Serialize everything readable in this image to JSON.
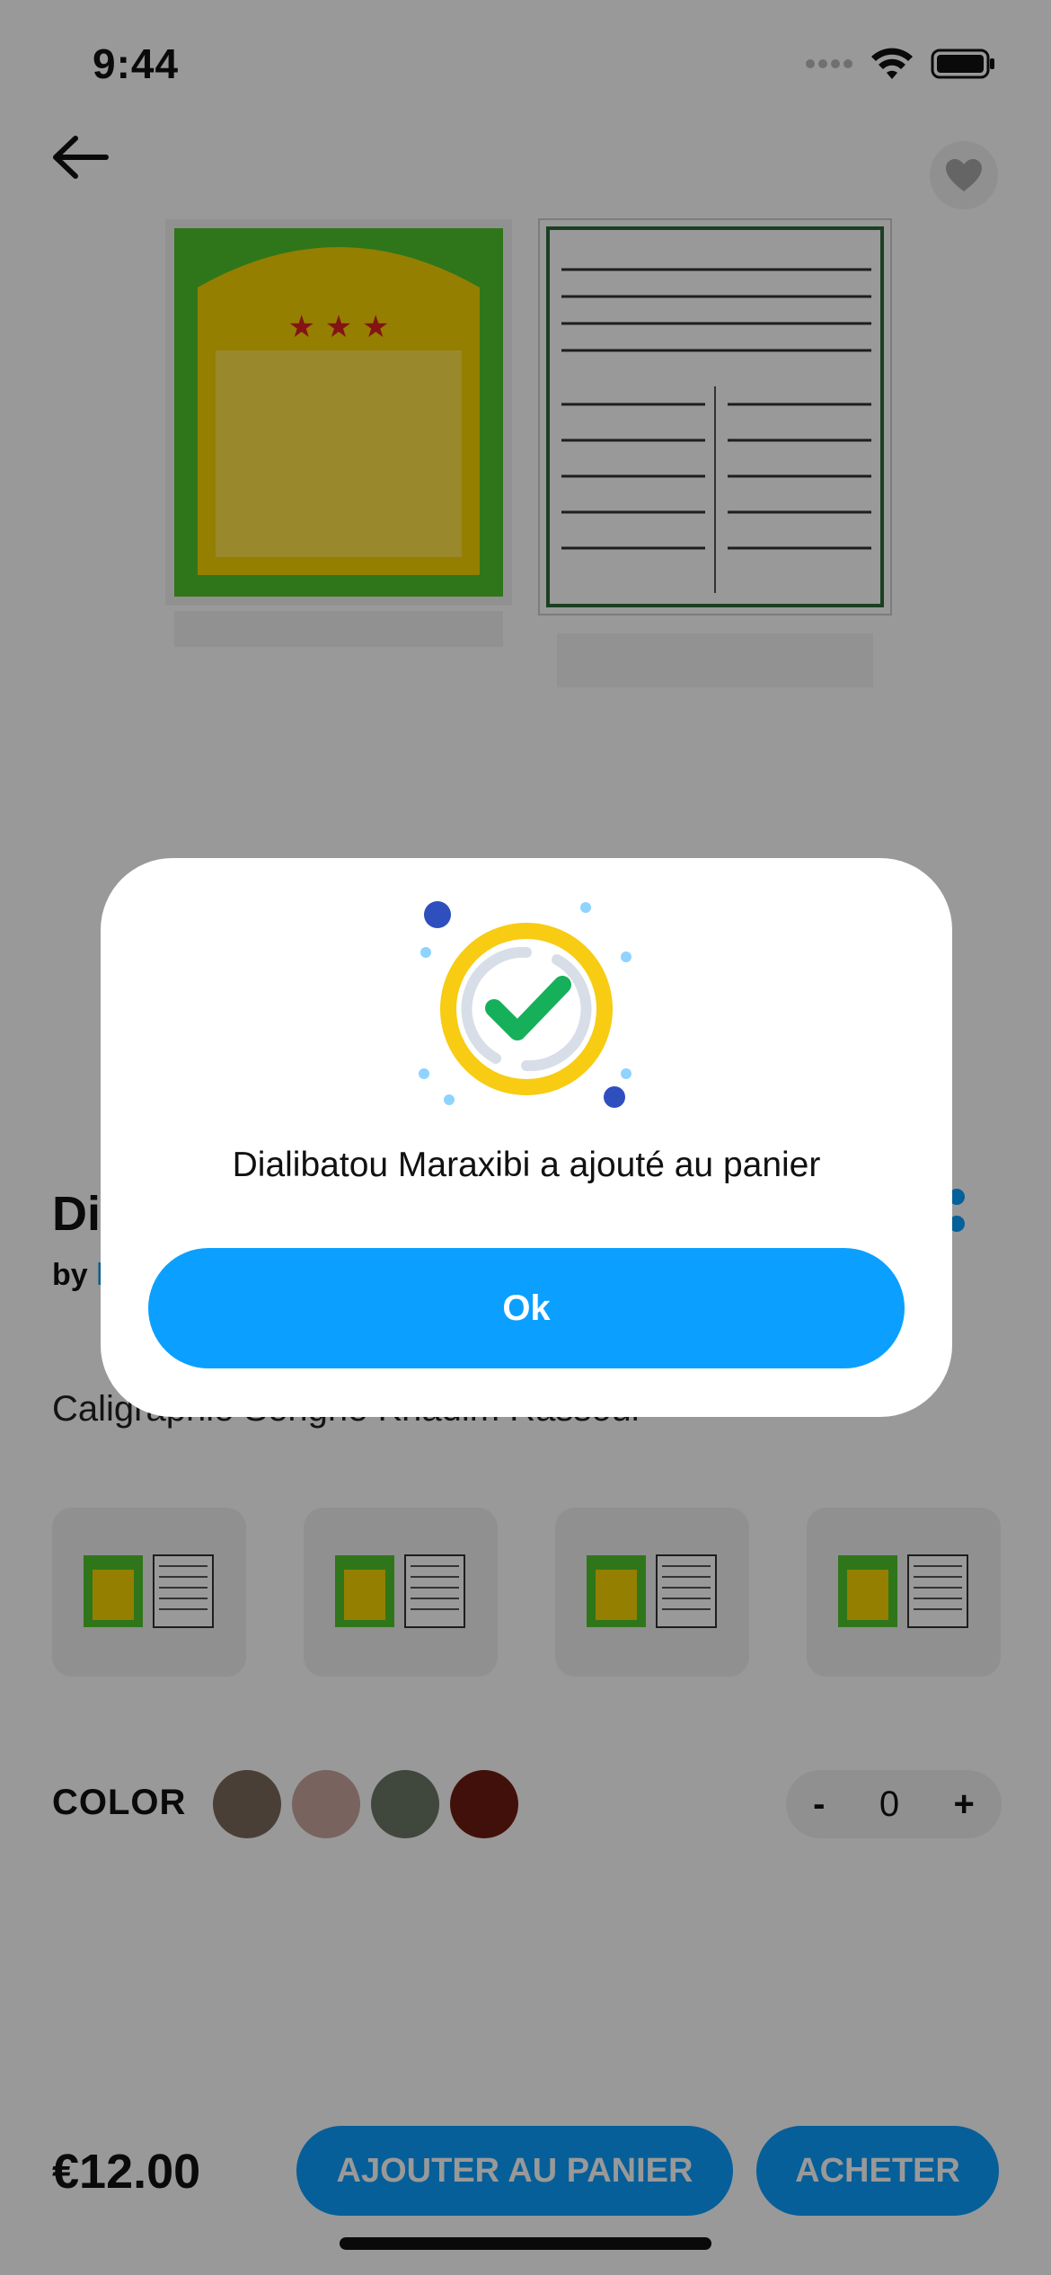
{
  "status_bar": {
    "time": "9:44"
  },
  "product": {
    "title": "Di",
    "author_prefix": "by",
    "author_name": "l",
    "description": "Caligraphie Serigne Khadim Rassoul",
    "price": "€12.00",
    "color_label": "COLOR",
    "colors": [
      "#7a6a5a",
      "#caa59d",
      "#6c7766",
      "#6e1c12"
    ],
    "quantity": {
      "minus": "-",
      "value": "0",
      "plus": "+"
    },
    "thumbnails_count": 4
  },
  "actions": {
    "add_to_cart": "AJOUTER AU PANIER",
    "buy": "ACHETER"
  },
  "dialog": {
    "message": "Dialibatou Maraxibi a ajouté au panier",
    "ok_label": "Ok",
    "icon": "success-check-icon"
  },
  "colors": {
    "accent": "#0ba0ff",
    "success_ring": "#f7cc12",
    "success_check": "#16b05a",
    "overlay": "rgba(0,0,0,0.40)"
  }
}
